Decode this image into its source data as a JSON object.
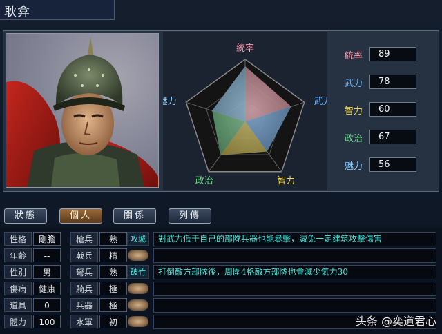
{
  "officer": {
    "name": "耿弇"
  },
  "radar": {
    "labels": [
      {
        "text": "統率",
        "color": "#ff9fb0"
      },
      {
        "text": "武力",
        "color": "#6fb6ff"
      },
      {
        "text": "智力",
        "color": "#f2d84a"
      },
      {
        "text": "政治",
        "color": "#6fdc8c"
      },
      {
        "text": "魅力",
        "color": "#8fd0ff"
      }
    ],
    "stat_max": 100
  },
  "stats": [
    {
      "label": "統率",
      "value": "89",
      "color": "#ff9fb0"
    },
    {
      "label": "武力",
      "value": "78",
      "color": "#6fb6ff"
    },
    {
      "label": "智力",
      "value": "60",
      "color": "#f2d84a"
    },
    {
      "label": "政治",
      "value": "67",
      "color": "#6fdc8c"
    },
    {
      "label": "魅力",
      "value": "56",
      "color": "#8fd0ff"
    }
  ],
  "tabs": [
    {
      "label": "狀態",
      "active": false
    },
    {
      "label": "個人",
      "active": true
    },
    {
      "label": "關係",
      "active": false
    },
    {
      "label": "列傳",
      "active": false
    }
  ],
  "personal": [
    {
      "label": "性格",
      "value": "剛膽"
    },
    {
      "label": "年齡",
      "value": "--"
    },
    {
      "label": "性別",
      "value": "男"
    },
    {
      "label": "傷病",
      "value": "健康"
    },
    {
      "label": "道具",
      "value": "0"
    },
    {
      "label": "體力",
      "value": "100"
    }
  ],
  "aptitude": [
    {
      "label": "槍兵",
      "value": "熟"
    },
    {
      "label": "戟兵",
      "value": "精"
    },
    {
      "label": "弩兵",
      "value": "熟"
    },
    {
      "label": "騎兵",
      "value": "極"
    },
    {
      "label": "兵器",
      "value": "極"
    },
    {
      "label": "水軍",
      "value": "初"
    }
  ],
  "skills": [
    {
      "name": "攻城",
      "desc": "對武力低于自己的部隊兵器也能暴擊，減免一定建筑攻擊傷害"
    },
    {
      "name": "",
      "desc": ""
    },
    {
      "name": "破竹",
      "desc": "打倒敵方部隊後，周圍4格敵方部隊也會減少氣力30"
    },
    {
      "name": "",
      "desc": ""
    },
    {
      "name": "",
      "desc": ""
    },
    {
      "name": "",
      "desc": ""
    }
  ],
  "watermark": "头条 @奕道君心"
}
